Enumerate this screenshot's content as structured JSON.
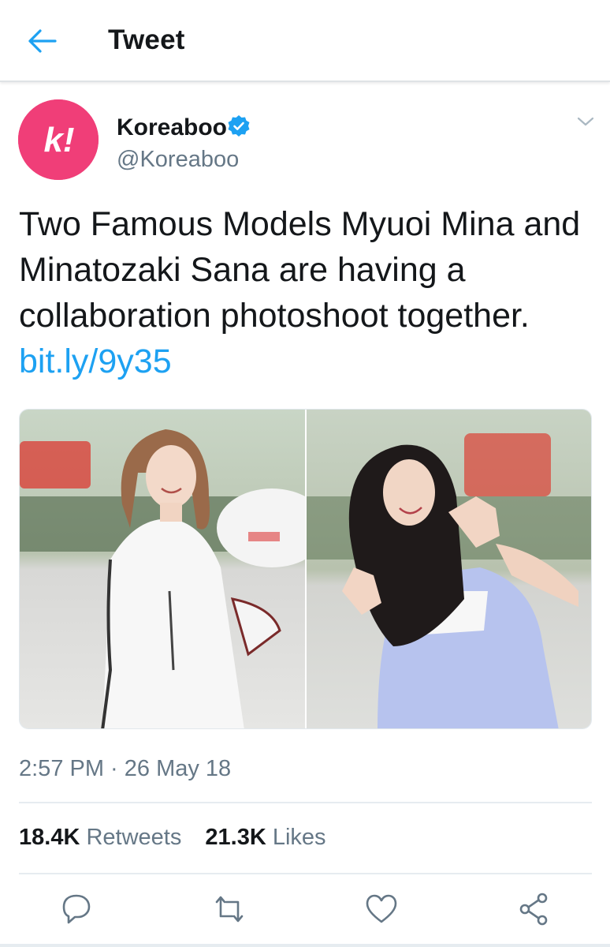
{
  "header": {
    "title": "Tweet",
    "back_icon": "arrow-left-icon"
  },
  "tweet": {
    "author": {
      "display_name": "Koreaboo",
      "handle": "@Koreaboo",
      "verified": true,
      "avatar_text": "k!",
      "avatar_color": "#f03e78"
    },
    "text": "Two Famous Models Myuoi Mina and Minatozaki Sana are having a collaboration photoshoot together.",
    "link": "bit.ly/9y35",
    "media": [
      {
        "icon": "photo-left"
      },
      {
        "icon": "photo-right"
      }
    ],
    "timestamp": "2:57 PM · 26 May 18",
    "retweets": {
      "count": "18.4K",
      "label": "Retweets"
    },
    "likes": {
      "count": "21.3K",
      "label": "Likes"
    }
  },
  "actions": [
    {
      "icon": "reply-icon"
    },
    {
      "icon": "retweet-icon"
    },
    {
      "icon": "like-icon"
    },
    {
      "icon": "share-icon"
    }
  ],
  "colors": {
    "accent": "#1da1f2",
    "text_primary": "#14171a",
    "text_secondary": "#657786",
    "avatar": "#f03e78"
  }
}
